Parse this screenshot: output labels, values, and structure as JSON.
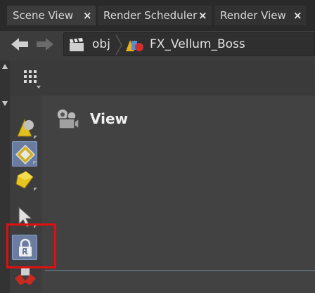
{
  "tabs": [
    {
      "label": "Scene View",
      "close": "×",
      "active": true
    },
    {
      "label": "Render Scheduler",
      "close": "×",
      "active": false
    },
    {
      "label": "Render View",
      "close": "×",
      "active": false
    }
  ],
  "breadcrumb": [
    {
      "label": "obj",
      "icon": "clapboard-icon"
    },
    {
      "label": "FX_Vellum_Boss",
      "icon": "shapes-icon"
    }
  ],
  "viewport": {
    "label": "View"
  },
  "toolbar": {
    "tools": [
      "view-cone-icon",
      "transform-handle-icon",
      "cube-select-icon",
      "select-arrow-icon",
      "lock-camera-icon",
      "object-stack-icon"
    ],
    "selected_tool": "lock-camera-icon"
  },
  "colors": {
    "highlight": "#e01010",
    "selected_bg": "#6a7da0"
  }
}
